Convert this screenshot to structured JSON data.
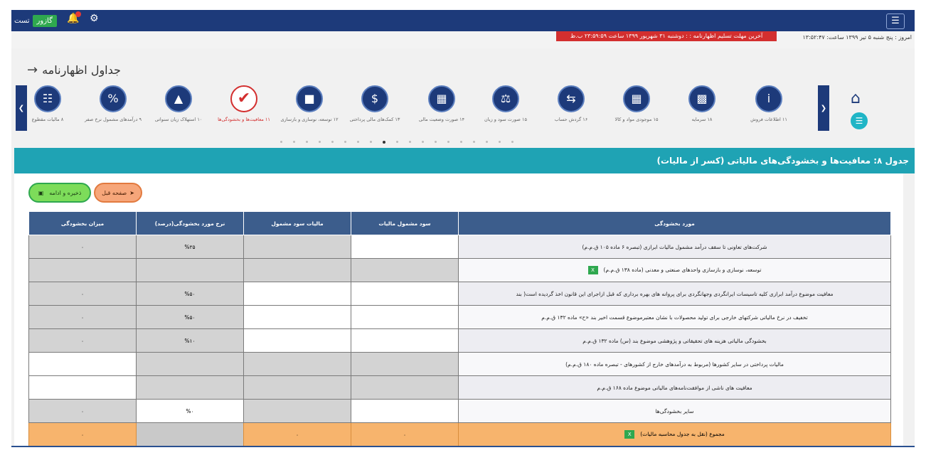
{
  "topbar": {
    "user_name": "گازور",
    "user_role": "تست",
    "menu_icon": "hamburger-icon"
  },
  "info": {
    "today": "امروز : پنج شنبه ۵ تیر ۱۳۹۹ ساعت: ۱۳:۵۲:۴۷",
    "deadline": "آخرین مهلت تسلیم اظهارنامه : : دوشنبه ۳۱ شهریور ۱۳۹۹ ساعت ۲۳:۵۹:۵۹ ب.ظ"
  },
  "page_title": "جداول اظهارنامه",
  "carousel": {
    "items": [
      {
        "label": "۱۱ اطلاعات فروش",
        "icon": "info-icon"
      },
      {
        "label": "۱۸ سرمایه",
        "icon": "coins-icon"
      },
      {
        "label": "۱۵ موجودی مواد و کالا",
        "icon": "inventory-icon"
      },
      {
        "label": "۱۶ گردش حساب",
        "icon": "exchange-icon"
      },
      {
        "label": "۱۵ صورت سود و زیان",
        "icon": "scale-icon"
      },
      {
        "label": "۱۴ صورت وضعیت مالی",
        "icon": "calculator-icon"
      },
      {
        "label": "۱۳ کمک‌های مالی پرداختی",
        "icon": "money-icon"
      },
      {
        "label": "۱۲ توسعه، نوسازی و بازسازی",
        "icon": "factory-icon"
      },
      {
        "label": "۱۱ معافیت‌ها و بخشودگی‌ها",
        "icon": "check-icon"
      },
      {
        "label": "۱۰ استهلاک زیان سنواتی",
        "icon": "chart-icon"
      },
      {
        "label": "۹ درآمدهای مشمول نرخ صفر",
        "icon": "percent-icon"
      },
      {
        "label": "۸ مالیات مقطوع",
        "icon": "calendar-icon"
      }
    ],
    "active_index": 8,
    "dot_count": 19,
    "active_dot": 8
  },
  "section_title": "جدول ۸: معافیت‌ها و بخشودگی‌های مالیاتی (کسر از مالیات)",
  "buttons": {
    "save": "ذخیره و ادامه",
    "prev": "صفحه قبل"
  },
  "table": {
    "headers": [
      "مورد بخشودگی",
      "سود مشمول مالیات",
      "مالیات سود مشمول",
      "نرخ مورد بخشودگی(درصد)",
      "میزان بخشودگی"
    ],
    "rows": [
      {
        "desc": "شرکت‌های تعاونی تا سقف درآمد مشمول مالیات ابرازی (تبصره ۶ ماده ۱۰۵ ق.م.م)",
        "rate": "%۲۵",
        "amount": "۰",
        "xl": ""
      },
      {
        "desc": "توسعه، نوسازی و بازسازی واحدهای صنعتی و معدنی (ماده ۱۳۸ ق.م.م)",
        "rate": "",
        "amount": "",
        "xl": "X"
      },
      {
        "desc": "معافیت موضوع درآمد ابرازی کلیه تاسیسات ایرانگردی وجهانگردی برای پروانه های بهره برداری که قبل ازاجرای این قانون اخذ گردیده است( بند",
        "rate": "%۵۰",
        "amount": "۰",
        "xl": ""
      },
      {
        "desc": "تخفیف در نرخ مالیاتی شرکتهای خارجی برای تولید محصولات با نشان معتبرموضوع قسمت اخیر بند «ح» ماده ۱۳۲ ق.م.م",
        "rate": "%۵۰",
        "amount": "۰",
        "xl": ""
      },
      {
        "desc": "بخشودگی مالیاتی هزینه های تحقیقاتی و پژوهشی موضوع بند (س) ماده ۱۳۲ ق.م.م",
        "rate": "%۱۰",
        "amount": "۰",
        "xl": ""
      },
      {
        "desc": "مالیات پرداختی در سایر کشورها (مربوط به درآمدهای خارج از کشورهای - تبصره ماده ۱۸۰ ق.م.م)",
        "rate": "",
        "amount": "",
        "xl": ""
      },
      {
        "desc": "معافیت های ناشی از موافقت‌نامه‌های مالیاتی موضوع ماده ۱۶۸ ق.م.م",
        "rate": "",
        "amount": "",
        "xl": ""
      },
      {
        "desc": "سایر بخشودگی‌ها",
        "rate": "%۰",
        "amount": "۰",
        "xl": ""
      }
    ],
    "total": {
      "desc": "مجموع (نقل به جدول محاسبه مالیات)",
      "col1": "۰",
      "col2": "۰",
      "amount": "۰",
      "xl": "X"
    }
  }
}
